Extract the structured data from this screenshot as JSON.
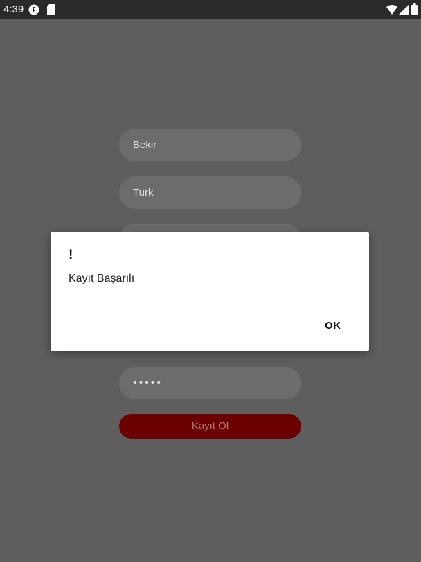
{
  "status_bar": {
    "time": "4:39",
    "icons": [
      "app-notification-icon",
      "sd-card-icon",
      "wifi-icon",
      "cellular-signal-icon",
      "battery-icon"
    ]
  },
  "form": {
    "first_name_value": "Bekir",
    "last_name_value": "Turk",
    "password_value": "•••••",
    "register_button_label": "Kayıt Ol"
  },
  "dialog": {
    "title": "!",
    "message": "Kayıt Başarılı",
    "ok_label": "OK"
  },
  "colors": {
    "background_dim": "#5e5e5e",
    "field_bg": "#6c6c6c",
    "button_bg": "#6b0000",
    "dialog_bg": "#ffffff"
  }
}
